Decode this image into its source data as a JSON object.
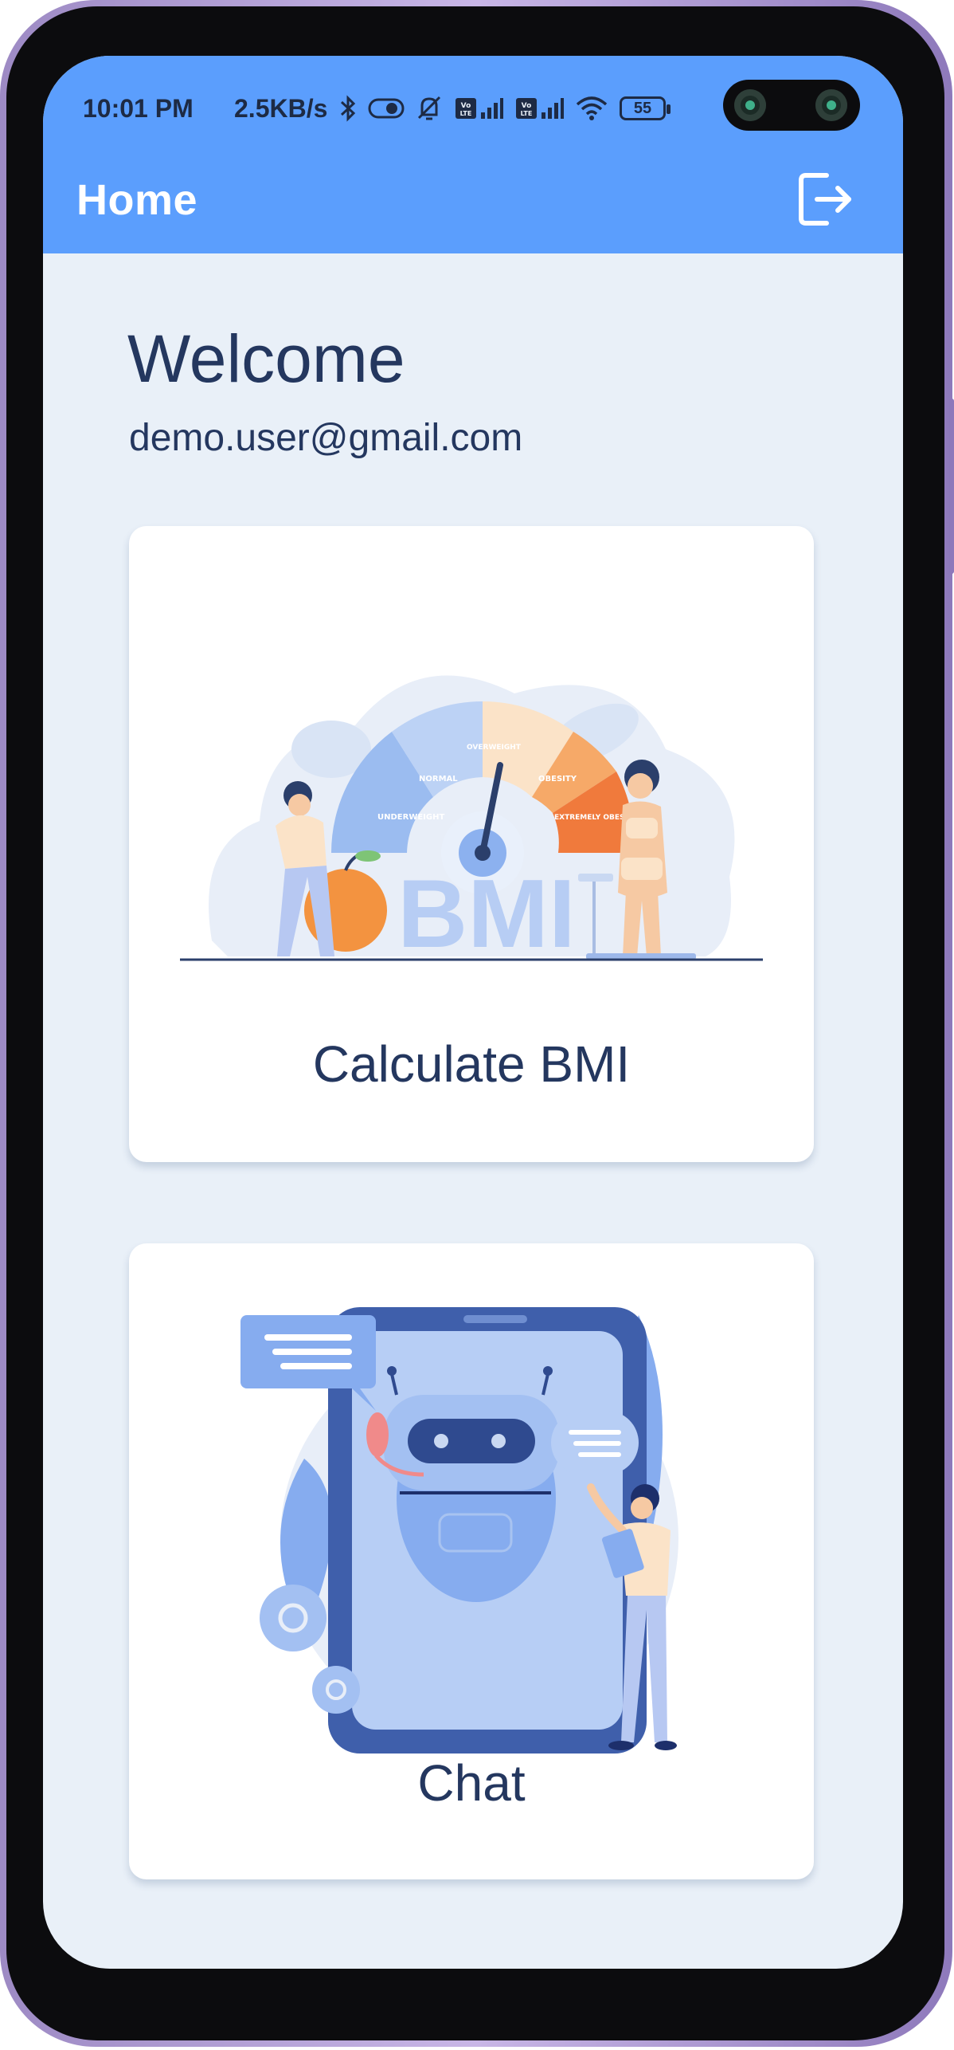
{
  "status_bar": {
    "time": "10:01 PM",
    "network_speed": "2.5KB/s",
    "battery": "55"
  },
  "app_bar": {
    "title": "Home",
    "logout_icon": "logout-icon",
    "color": "#5b9efd"
  },
  "main": {
    "greeting": "Welcome",
    "email": "demo.user@gmail.com",
    "cards": [
      {
        "label": "Calculate BMI",
        "illustration": "bmi-gauge-illustration",
        "gauge_labels": [
          "UNDERWEIGHT",
          "NORMAL",
          "OVERWEIGHT",
          "OBESITY",
          "EXTREMELY OBESITY"
        ],
        "art_text": "BMI"
      },
      {
        "label": "Chat",
        "illustration": "chatbot-illustration"
      }
    ]
  },
  "colors": {
    "background": "#e9f0f8",
    "text": "#24375f",
    "accent": "#5b9efd"
  }
}
